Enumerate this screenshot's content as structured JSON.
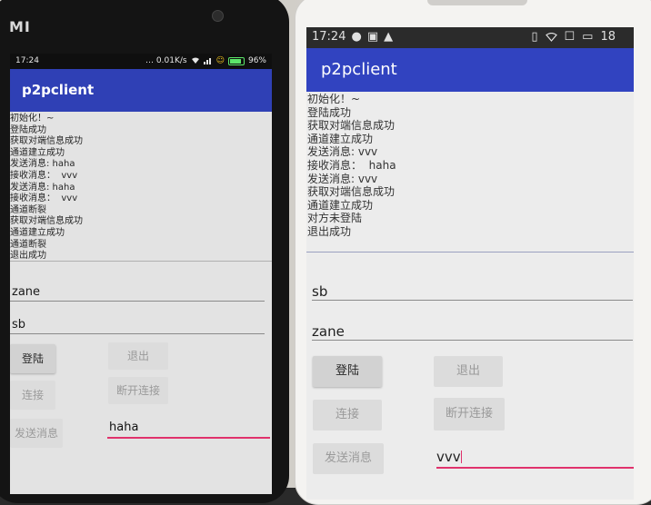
{
  "left_phone": {
    "brand": "MI",
    "status_bar": {
      "time": "17:24",
      "speed": "0.01K/s",
      "battery": "96%"
    },
    "app_title": "p2pclient",
    "log_lines": [
      "初始化！~",
      "登陆成功",
      "获取对端信息成功",
      "通道建立成功",
      "发送消息: haha",
      "接收消息：  vvv",
      "发送消息: haha",
      "接收消息：  vvv",
      "通道断裂",
      "获取对端信息成功",
      "通道建立成功",
      "通道断裂",
      "退出成功"
    ],
    "username_value": "zane",
    "peer_value": "sb",
    "buttons": {
      "login": "登陆",
      "logout": "退出",
      "connect": "连接",
      "disconnect": "断开连接",
      "send": "发送消息"
    },
    "message_value": "haha"
  },
  "right_phone": {
    "status_bar": {
      "time": "17:24",
      "right_text": "18"
    },
    "app_title": "p2pclient",
    "log_lines": [
      "初始化！~",
      "登陆成功",
      "获取对端信息成功",
      "通道建立成功",
      "发送消息: vvv",
      "接收消息：  haha",
      "发送消息: vvv",
      "获取对端信息成功",
      "通道建立成功",
      "对方未登陆",
      "退出成功"
    ],
    "username_value": "sb",
    "peer_value": "zane",
    "buttons": {
      "login": "登陆",
      "logout": "退出",
      "connect": "连接",
      "disconnect": "断开连接",
      "send": "发送消息"
    },
    "message_value": "vvv"
  },
  "colors": {
    "appbar_blue": "#3143c0",
    "input_accent": "#e0326c"
  },
  "icons": [
    "wifi-icon",
    "signal-icon",
    "battery-icon",
    "chat-icon",
    "image-icon",
    "warning-icon",
    "vibrate-icon"
  ]
}
